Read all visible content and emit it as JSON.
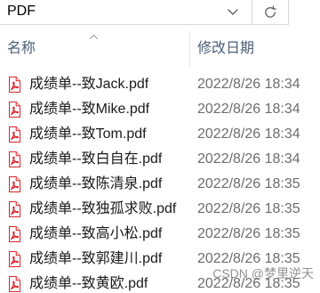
{
  "address_bar": {
    "path": "PDF",
    "dropdown_icon": "chevron-down-icon",
    "refresh_icon": "refresh-icon"
  },
  "columns": {
    "name": "名称",
    "modified": "修改日期",
    "sort_icon": "sort-ascending-icon"
  },
  "files": [
    {
      "name": "成绩单--致Jack.pdf",
      "modified": "2022/8/26 18:34",
      "icon": "pdf-file-icon"
    },
    {
      "name": "成绩单--致Mike.pdf",
      "modified": "2022/8/26 18:34",
      "icon": "pdf-file-icon"
    },
    {
      "name": "成绩单--致Tom.pdf",
      "modified": "2022/8/26 18:34",
      "icon": "pdf-file-icon"
    },
    {
      "name": "成绩单--致白自在.pdf",
      "modified": "2022/8/26 18:34",
      "icon": "pdf-file-icon"
    },
    {
      "name": "成绩单--致陈清泉.pdf",
      "modified": "2022/8/26 18:35",
      "icon": "pdf-file-icon"
    },
    {
      "name": "成绩单--致独孤求败.pdf",
      "modified": "2022/8/26 18:35",
      "icon": "pdf-file-icon"
    },
    {
      "name": "成绩单--致高小松.pdf",
      "modified": "2022/8/26 18:35",
      "icon": "pdf-file-icon"
    },
    {
      "name": "成绩单--致郭建川.pdf",
      "modified": "2022/8/26 18:35",
      "icon": "pdf-file-icon"
    },
    {
      "name": "成绩单--致黄欧.pdf",
      "modified": "2022/8/26 18:35",
      "icon": "pdf-file-icon"
    }
  ],
  "watermark": "CSDN @梦里逆天",
  "colors": {
    "pdf_icon": "#d9252b",
    "header_text": "#4c607a",
    "file_name_text": "#1a1a1a",
    "date_text": "#6d6d6d",
    "border": "#d9d9d9"
  }
}
